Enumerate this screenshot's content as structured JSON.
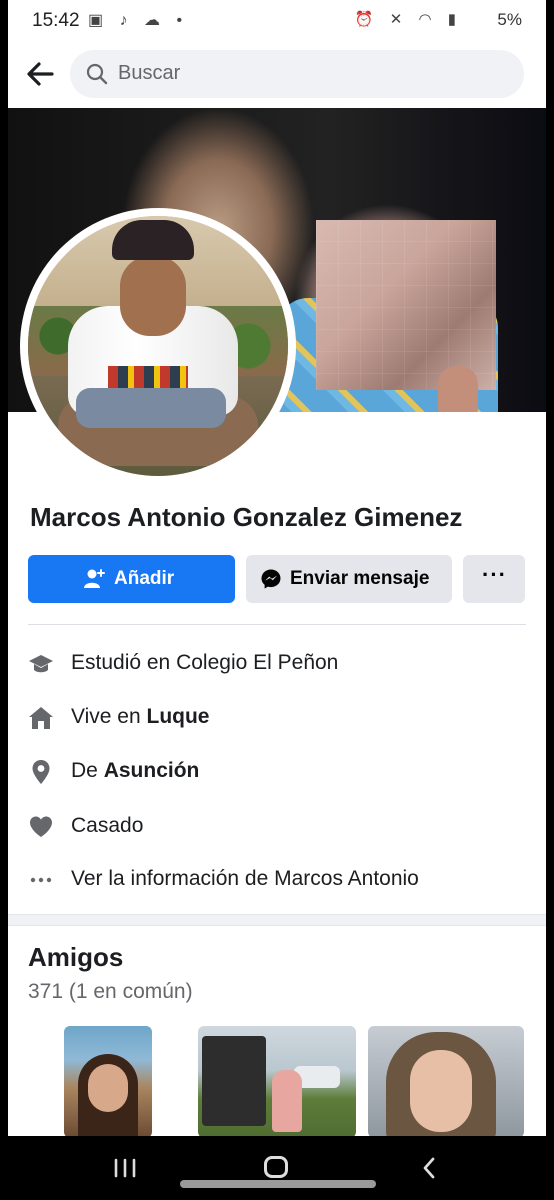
{
  "status_bar": {
    "time": "15:42",
    "left_icons": [
      "image-icon",
      "tiktok-icon",
      "cloud-icon",
      "dot-icon"
    ],
    "right_icons": [
      "alarm-icon",
      "mute-icon",
      "wifi-icon",
      "signal-icon",
      "battery-icon"
    ],
    "battery": "5%"
  },
  "header": {
    "search_placeholder": "Buscar"
  },
  "profile": {
    "name": "Marcos Antonio Gonzalez Gimenez",
    "add_label": "Añadir",
    "message_label": "Enviar mensaje",
    "more_label": "···"
  },
  "info": {
    "studied": "Estudió en Colegio El Peñon",
    "lives_prefix": "Vive en ",
    "lives_city": "Luque",
    "from_prefix": "De ",
    "from_city": "Asunción",
    "relationship": "Casado",
    "see_more": "Ver la información de Marcos Antonio"
  },
  "friends": {
    "title": "Amigos",
    "count": "371 (1 en común)"
  },
  "colors": {
    "accent": "#1877f2",
    "secondary_button": "#e4e6eb",
    "text": "#1c1e21",
    "muted_text": "#65676b"
  }
}
